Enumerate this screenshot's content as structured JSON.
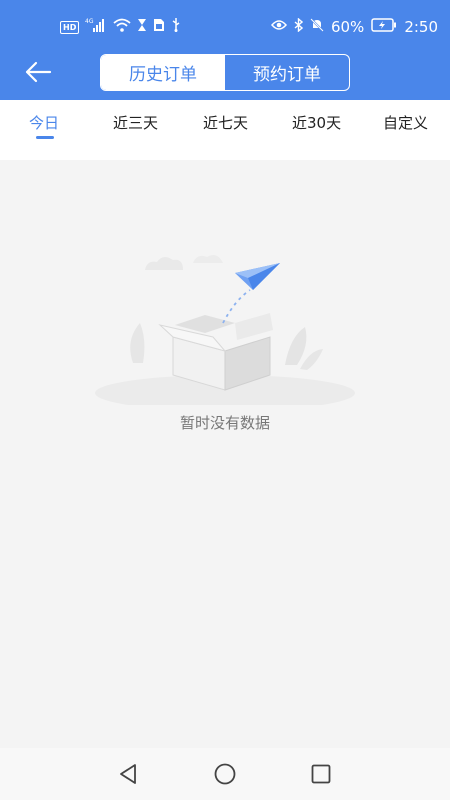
{
  "status_bar": {
    "left_badge": "HD",
    "network": "4G",
    "battery_percent": "60%",
    "time": "2:50",
    "icons": [
      "hd-icon",
      "signal-icon",
      "wifi-icon",
      "hourglass-icon",
      "sim-card-icon",
      "usb-icon",
      "eye-icon",
      "bluetooth-icon",
      "mute-icon",
      "battery-icon"
    ]
  },
  "header": {
    "back_icon": "arrow-left-icon",
    "segments": [
      {
        "label": "历史订单",
        "active": true
      },
      {
        "label": "预约订单",
        "active": false
      }
    ]
  },
  "tabs": [
    {
      "label": "今日",
      "active": true
    },
    {
      "label": "近三天",
      "active": false
    },
    {
      "label": "近七天",
      "active": false
    },
    {
      "label": "近30天",
      "active": false
    },
    {
      "label": "自定义",
      "active": false
    }
  ],
  "empty_state": {
    "illustration": "empty-box-paper-plane-illustration",
    "message": "暂时没有数据"
  },
  "nav_bar": {
    "buttons": [
      "back-triangle-icon",
      "home-circle-icon",
      "recents-square-icon"
    ]
  },
  "colors": {
    "primary": "#4a86ea",
    "background": "#f4f4f4",
    "tab_text": "#222222",
    "empty_text": "#777777"
  }
}
